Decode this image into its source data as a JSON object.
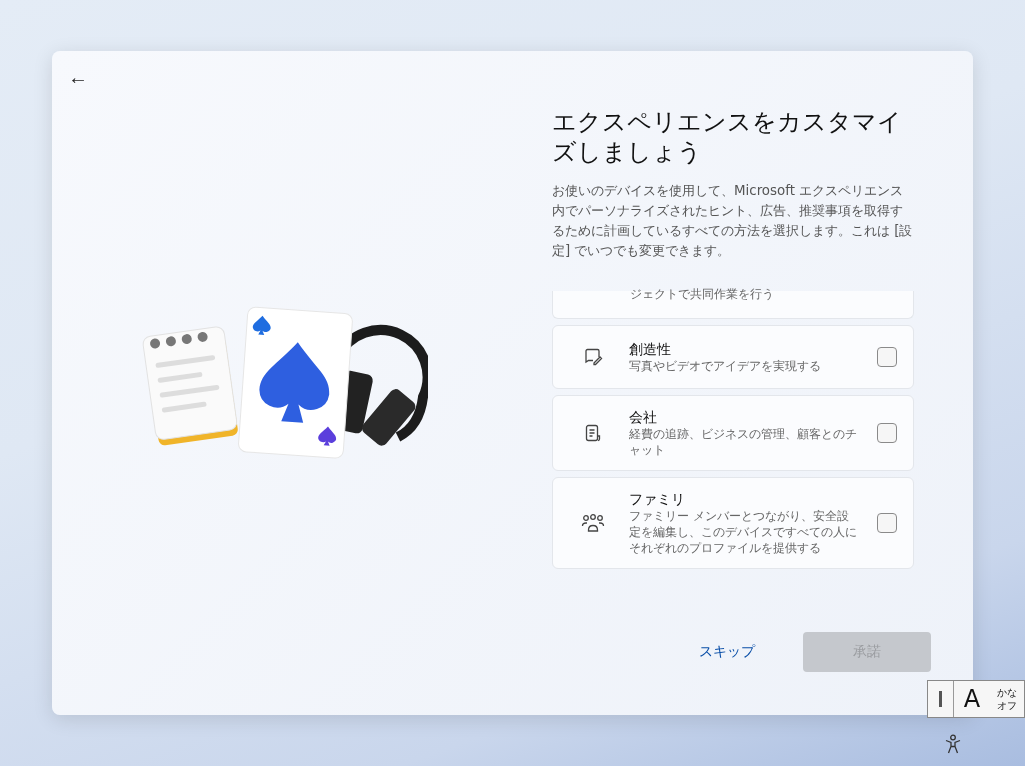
{
  "dialog": {
    "back_button": "←",
    "title": "エクスペリエンスをカスタマイズしましょう",
    "description": "お使いのデバイスを使用して、Microsoft エクスペリエンス内でパーソナライズされたヒント、広告、推奨事項を取得するために計画しているすべての方法を選択します。これは [設定] でいつでも変更できます。",
    "partial_option": {
      "description": "ジェクトで共同作業を行う"
    },
    "options": [
      {
        "title": "創造性",
        "description": "写真やビデオでアイデアを実現する",
        "checked": false
      },
      {
        "title": "会社",
        "description": "経費の追跡、ビジネスの管理、顧客とのチャット",
        "checked": false
      },
      {
        "title": "ファミリ",
        "description": "ファミリー メンバーとつながり、安全設定を編集し、このデバイスですべての人にそれぞれのプロファイルを提供する",
        "checked": false
      }
    ],
    "skip_link": "スキップ",
    "accept_button": {
      "label": "承諾",
      "disabled": true
    }
  },
  "ime_indicator": {
    "mode": "A",
    "kana_top": "かな",
    "kana_bottom": "オフ"
  }
}
